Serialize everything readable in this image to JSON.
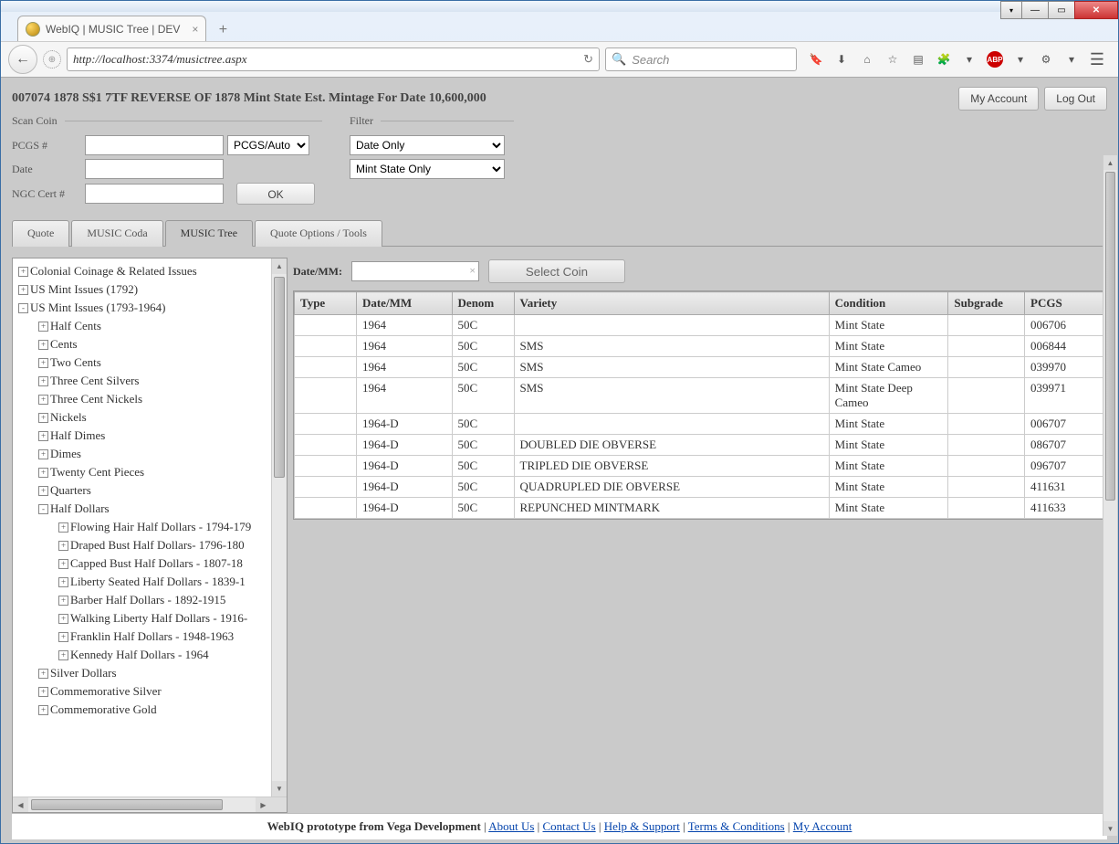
{
  "browser": {
    "tab_title": "WebIQ | MUSIC Tree | DEV",
    "url": "http://localhost:3374/musictree.aspx",
    "search_placeholder": "Search"
  },
  "header": {
    "title": "007074 1878 S$1 7TF REVERSE OF 1878 Mint State Est. Mintage For Date 10,600,000",
    "my_account": "My Account",
    "log_out": "Log Out"
  },
  "scan": {
    "legend": "Scan Coin",
    "pcgs_label": "PCGS #",
    "pcgs_auto": "PCGS/Auto",
    "date_label": "Date",
    "ngc_label": "NGC Cert #",
    "ok": "OK"
  },
  "filter": {
    "legend": "Filter",
    "date_only": "Date Only",
    "mint_state_only": "Mint State Only"
  },
  "tabs": {
    "quote": "Quote",
    "music_coda": "MUSIC Coda",
    "music_tree": "MUSIC Tree",
    "quote_options": "Quote Options / Tools"
  },
  "tree": [
    {
      "level": 0,
      "icon": "+",
      "label": "Colonial Coinage & Related Issues"
    },
    {
      "level": 0,
      "icon": "+",
      "label": "US Mint Issues (1792)"
    },
    {
      "level": 0,
      "icon": "-",
      "label": "US Mint Issues (1793-1964)"
    },
    {
      "level": 1,
      "icon": "+",
      "label": "Half Cents"
    },
    {
      "level": 1,
      "icon": "+",
      "label": "Cents"
    },
    {
      "level": 1,
      "icon": "+",
      "label": "Two Cents"
    },
    {
      "level": 1,
      "icon": "+",
      "label": "Three Cent Silvers"
    },
    {
      "level": 1,
      "icon": "+",
      "label": "Three Cent Nickels"
    },
    {
      "level": 1,
      "icon": "+",
      "label": "Nickels"
    },
    {
      "level": 1,
      "icon": "+",
      "label": "Half Dimes"
    },
    {
      "level": 1,
      "icon": "+",
      "label": "Dimes"
    },
    {
      "level": 1,
      "icon": "+",
      "label": "Twenty Cent Pieces"
    },
    {
      "level": 1,
      "icon": "+",
      "label": "Quarters"
    },
    {
      "level": 1,
      "icon": "-",
      "label": "Half Dollars"
    },
    {
      "level": 2,
      "icon": "+",
      "label": "Flowing Hair Half Dollars - 1794-179"
    },
    {
      "level": 2,
      "icon": "+",
      "label": "Draped Bust Half Dollars- 1796-180"
    },
    {
      "level": 2,
      "icon": "+",
      "label": "Capped Bust Half Dollars - 1807-18"
    },
    {
      "level": 2,
      "icon": "+",
      "label": "Liberty Seated Half Dollars - 1839-1"
    },
    {
      "level": 2,
      "icon": "+",
      "label": "Barber Half Dollars - 1892-1915"
    },
    {
      "level": 2,
      "icon": "+",
      "label": "Walking Liberty Half Dollars - 1916-"
    },
    {
      "level": 2,
      "icon": "+",
      "label": "Franklin Half Dollars - 1948-1963"
    },
    {
      "level": 2,
      "icon": "+",
      "label": "Kennedy Half Dollars - 1964"
    },
    {
      "level": 1,
      "icon": "+",
      "label": "Silver Dollars"
    },
    {
      "level": 1,
      "icon": "+",
      "label": "Commemorative Silver"
    },
    {
      "level": 1,
      "icon": "+",
      "label": "Commemorative Gold"
    }
  ],
  "detail": {
    "date_mm_label": "Date/MM:",
    "select_coin": "Select Coin",
    "columns": [
      "Type",
      "Date/MM",
      "Denom",
      "Variety",
      "Condition",
      "Subgrade",
      "PCGS"
    ],
    "rows": [
      {
        "type": "",
        "date": "1964",
        "denom": "50C",
        "variety": "",
        "condition": "Mint State",
        "subgrade": "",
        "pcgs": "006706"
      },
      {
        "type": "",
        "date": "1964",
        "denom": "50C",
        "variety": "SMS",
        "condition": "Mint State",
        "subgrade": "",
        "pcgs": "006844"
      },
      {
        "type": "",
        "date": "1964",
        "denom": "50C",
        "variety": "SMS",
        "condition": "Mint State Cameo",
        "subgrade": "",
        "pcgs": "039970"
      },
      {
        "type": "",
        "date": "1964",
        "denom": "50C",
        "variety": "SMS",
        "condition": "Mint State Deep Cameo",
        "subgrade": "",
        "pcgs": "039971"
      },
      {
        "type": "",
        "date": "1964-D",
        "denom": "50C",
        "variety": "",
        "condition": "Mint State",
        "subgrade": "",
        "pcgs": "006707"
      },
      {
        "type": "",
        "date": "1964-D",
        "denom": "50C",
        "variety": "DOUBLED DIE OBVERSE",
        "condition": "Mint State",
        "subgrade": "",
        "pcgs": "086707"
      },
      {
        "type": "",
        "date": "1964-D",
        "denom": "50C",
        "variety": "TRIPLED DIE OBVERSE",
        "condition": "Mint State",
        "subgrade": "",
        "pcgs": "096707"
      },
      {
        "type": "",
        "date": "1964-D",
        "denom": "50C",
        "variety": "QUADRUPLED DIE OBVERSE",
        "condition": "Mint State",
        "subgrade": "",
        "pcgs": "411631"
      },
      {
        "type": "",
        "date": "1964-D",
        "denom": "50C",
        "variety": "REPUNCHED MINTMARK",
        "condition": "Mint State",
        "subgrade": "",
        "pcgs": "411633"
      }
    ]
  },
  "footer": {
    "prefix": "WebIQ prototype from Vega Development",
    "about": "About Us",
    "contact": "Contact Us",
    "help": "Help & Support",
    "terms": "Terms & Conditions",
    "account": "My Account"
  }
}
